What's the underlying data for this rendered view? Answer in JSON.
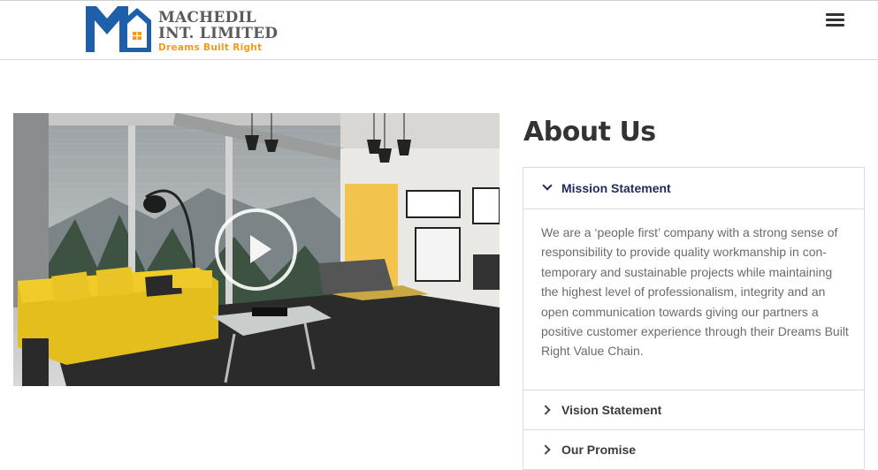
{
  "header": {
    "logo": {
      "line1": "MACHEDIL",
      "line2": "INT. LIMITED",
      "tagline": "Dreams Built Right",
      "colors": {
        "blue": "#1d5fa8",
        "orange": "#f39a1e",
        "gray": "#5b5b5b"
      }
    },
    "menu_icon": "hamburger-menu-icon"
  },
  "video": {
    "play_icon": "play-icon"
  },
  "about": {
    "title": "About Us",
    "accordion": [
      {
        "label": "Mission Statement",
        "expanded": true,
        "icon": "chevron-down-icon",
        "body": "We are a ‘people first’ company with a strong sense of responsibility to provide quality workmanship in con-temporary and sustainable projects while maintaining the highest level of professionalism, integrity and an open communication towards giving our partners a positive customer experience through their Dreams Built Right Value Chain."
      },
      {
        "label": "Vision Statement",
        "expanded": false,
        "icon": "chevron-right-icon"
      },
      {
        "label": "Our Promise",
        "expanded": false,
        "icon": "chevron-right-icon"
      }
    ],
    "colors": {
      "accent": "#1f2b5a",
      "body_text": "#6b6b6b",
      "border": "#dcdcdc"
    }
  }
}
